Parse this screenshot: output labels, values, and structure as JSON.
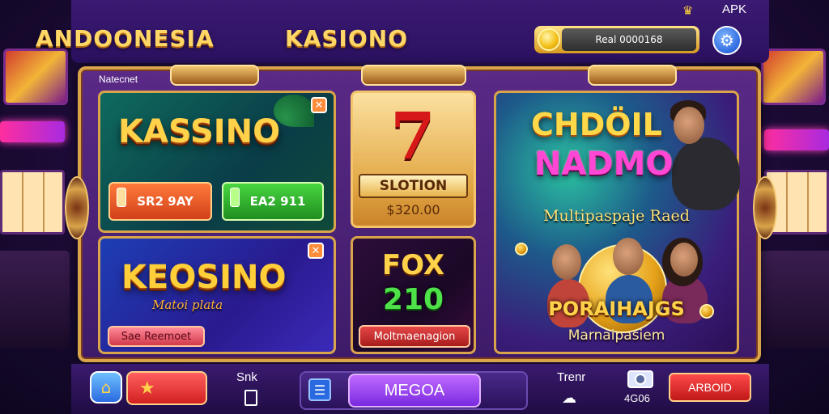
{
  "header": {
    "title_left": "ANDOONESIA",
    "title_right": "KASIONO",
    "balance": "Real 0000168",
    "apk_label": "APK"
  },
  "frame": {
    "label": "Natecnet"
  },
  "tiles": {
    "kassino": {
      "title": "KASSINO",
      "btn_left": "SR2 9AY",
      "btn_right": "EA2 911"
    },
    "keosino": {
      "title": "KEOSINO",
      "subtitle": "Matoi plata",
      "button": "Sae Reemoet"
    },
    "slotion": {
      "symbol": "7",
      "label": "SLOTION",
      "price": "$320.00"
    },
    "fox": {
      "title": "FOX",
      "number": "210",
      "button": "Moltmaenagion"
    },
    "feature": {
      "line1": "CHDÖIL",
      "line2": "NADMO",
      "tagline": "Multipaspaje Raed",
      "title2": "PORAIHAJGS",
      "subtitle2": "Marnaipasiem"
    }
  },
  "bottom": {
    "snk_label": "Snk",
    "mega_label": "MEGOA",
    "trenr_label": "Trenr",
    "cam_label": "4G06",
    "arbo_label": "ARBOID"
  },
  "colors": {
    "background": "#1c0b36",
    "gold": "#ffd24a",
    "frame_border": "#d9a44a",
    "accent_purple": "#7a2ae0",
    "accent_red": "#d22020"
  }
}
